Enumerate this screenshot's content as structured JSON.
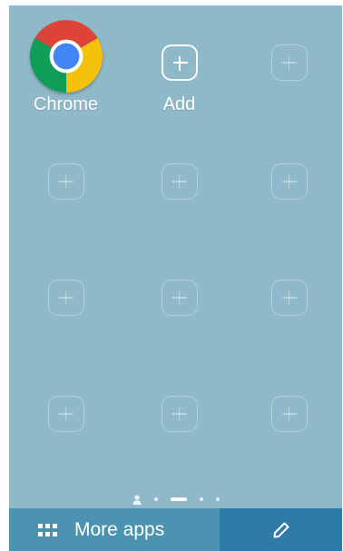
{
  "home_grid": {
    "apps": [
      {
        "label": "Chrome",
        "icon": "chrome-icon"
      },
      {
        "label": "Add",
        "icon": "add-icon"
      }
    ],
    "empty_slot_icon": "plus-slot-icon",
    "empty_slot_count": 10
  },
  "page_indicator": {
    "pages": [
      "user-page",
      "page",
      "page",
      "page",
      "page"
    ],
    "active_index": 2
  },
  "bottom_bar": {
    "more_apps_label": "More apps",
    "more_apps_icon": "app-grid-icon",
    "edit_icon": "pencil-icon"
  },
  "colors": {
    "background": "#8fb9c8",
    "more_apps_bg": "#4b93b0",
    "edit_bg": "#2e7aa8"
  }
}
